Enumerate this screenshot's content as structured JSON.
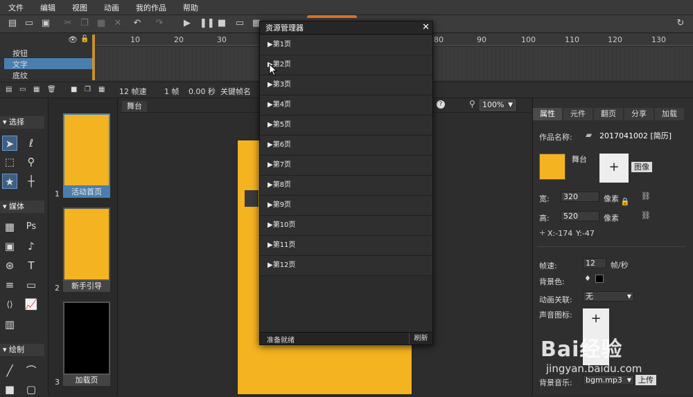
{
  "menu": [
    "文件",
    "编辑",
    "视图",
    "动画",
    "我的作品",
    "帮助"
  ],
  "timeline": {
    "ruler": [
      "10",
      "20",
      "30",
      "80",
      "90",
      "100",
      "110",
      "120",
      "130"
    ],
    "tracks": [
      "按钮",
      "文字",
      "底纹"
    ],
    "status": {
      "fps": "12 帧速",
      "frame": "1 帧",
      "time": "0.00 秒",
      "keyframe": "关键帧名"
    }
  },
  "left": {
    "sections": [
      "选择",
      "媒体",
      "绘制"
    ],
    "tools": [
      "arrow-icon",
      "lasso-icon",
      "transform-icon",
      "magnify-icon",
      "star-icon",
      "grid-icon",
      "ps-icon",
      "image-icon",
      "sound-icon",
      "film-icon",
      "text-icon",
      "paragraph-icon",
      "slide-icon",
      "code-icon",
      "chart-icon",
      "barcode-icon",
      "line-icon",
      "curve-icon"
    ]
  },
  "pages": [
    {
      "num": "1",
      "label": "活动首页",
      "color": "#f4b321"
    },
    {
      "num": "2",
      "label": "新手引导",
      "color": "#f4b321"
    },
    {
      "num": "3",
      "label": "加载页",
      "color": "#000000"
    }
  ],
  "stage": {
    "tab": "舞台",
    "zoom": "100%"
  },
  "right": {
    "tabs": [
      "属性",
      "元件",
      "翻页",
      "分享",
      "加载"
    ],
    "work_name_label": "作品名称:",
    "work_name": "2017041002 [简历]",
    "stage_label": "舞台",
    "image_btn": "图像",
    "width_label": "宽:",
    "width": "320",
    "height_label": "高:",
    "height": "520",
    "unit": "像素",
    "x": "X:-174",
    "y": "Y:-47",
    "fps_label": "帧速:",
    "fps": "12",
    "fps_unit": "帧/秒",
    "bg_label": "背景色:",
    "anim_label": "动画关联:",
    "anim_value": "无",
    "sound_icon_label": "声音图标:",
    "music_label": "背景音乐:",
    "music_value": "bgm.mp3",
    "upload": "上传"
  },
  "modal": {
    "title": "资源管理器",
    "items": [
      "▶第1页",
      "▶第2页",
      "▶第3页",
      "▶第4页",
      "▶第5页",
      "▶第6页",
      "▶第7页",
      "▶第8页",
      "▶第9页",
      "▶第10页",
      "▶第11页",
      "▶第12页"
    ],
    "status": "准备就绪",
    "refresh": "刷新"
  },
  "watermark": {
    "brand": "Bai经验",
    "url": "jingyan.baidu.com"
  }
}
